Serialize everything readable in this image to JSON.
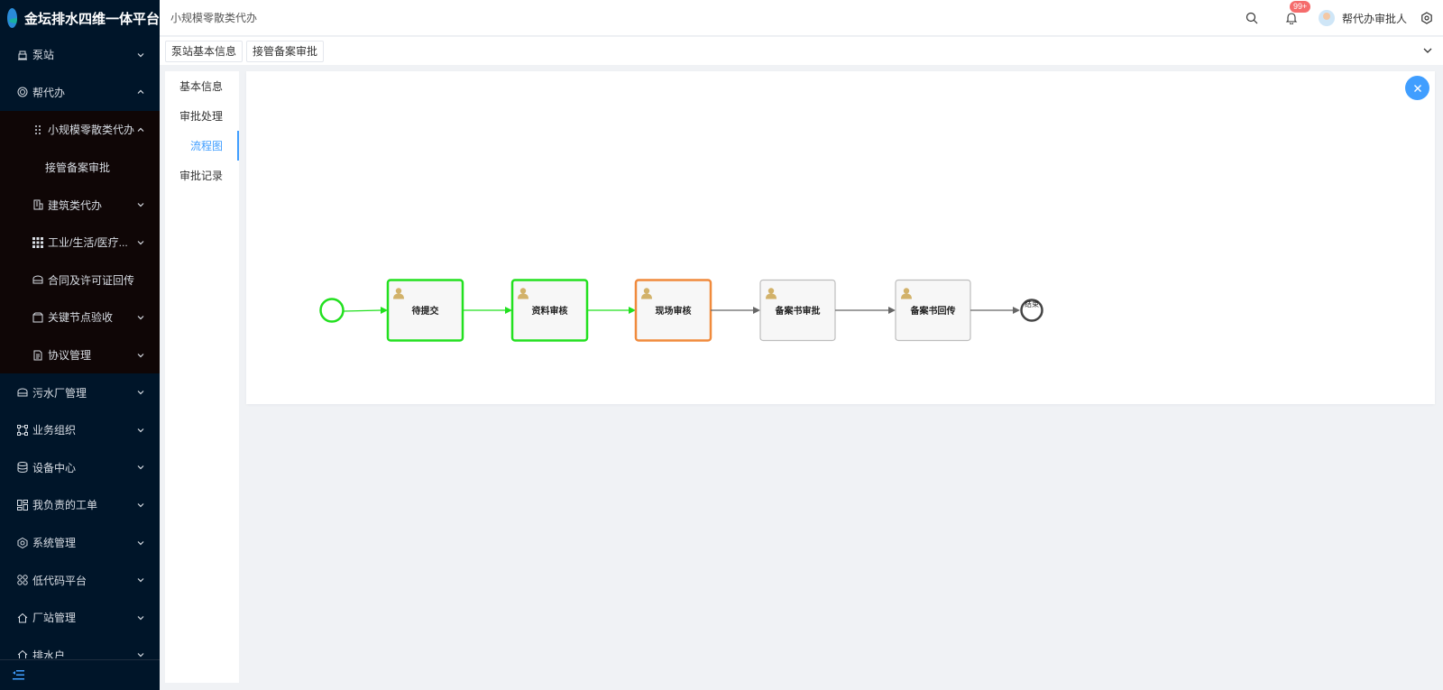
{
  "app": {
    "title": "金坛排水四维一体平台"
  },
  "sidebar": {
    "items": [
      {
        "label": "泵站"
      },
      {
        "label": "帮代办"
      },
      {
        "label": "小规模零散类代办"
      },
      {
        "label": "接管备案审批"
      },
      {
        "label": "建筑类代办"
      },
      {
        "label": "工业/生活/医疗..."
      },
      {
        "label": "合同及许可证回传"
      },
      {
        "label": "关键节点验收"
      },
      {
        "label": "协议管理"
      },
      {
        "label": "污水厂管理"
      },
      {
        "label": "业务组织"
      },
      {
        "label": "设备中心"
      },
      {
        "label": "我负责的工单"
      },
      {
        "label": "系统管理"
      },
      {
        "label": "低代码平台"
      },
      {
        "label": "厂站管理"
      },
      {
        "label": "排水户"
      }
    ]
  },
  "header": {
    "breadcrumb": "小规模零散类代办",
    "notifications_badge": "99+",
    "user_name": "帮代办审批人"
  },
  "tabs": [
    {
      "label": "泵站基本信息"
    },
    {
      "label": "接管备案审批"
    }
  ],
  "side_nav": [
    {
      "label": "基本信息"
    },
    {
      "label": "审批处理"
    },
    {
      "label": "流程图"
    },
    {
      "label": "审批记录"
    }
  ],
  "flow": {
    "nodes": [
      {
        "label": "待提交",
        "status": "completed"
      },
      {
        "label": "资料审核",
        "status": "completed"
      },
      {
        "label": "现场审核",
        "status": "current"
      },
      {
        "label": "备案书审批",
        "status": "pending"
      },
      {
        "label": "备案书回传",
        "status": "pending"
      }
    ],
    "end_label": "结束",
    "colors": {
      "completed": "#22e01f",
      "current": "#f08a3c",
      "pending": "#bdbdbd",
      "pending_arrow": "#666666"
    }
  }
}
